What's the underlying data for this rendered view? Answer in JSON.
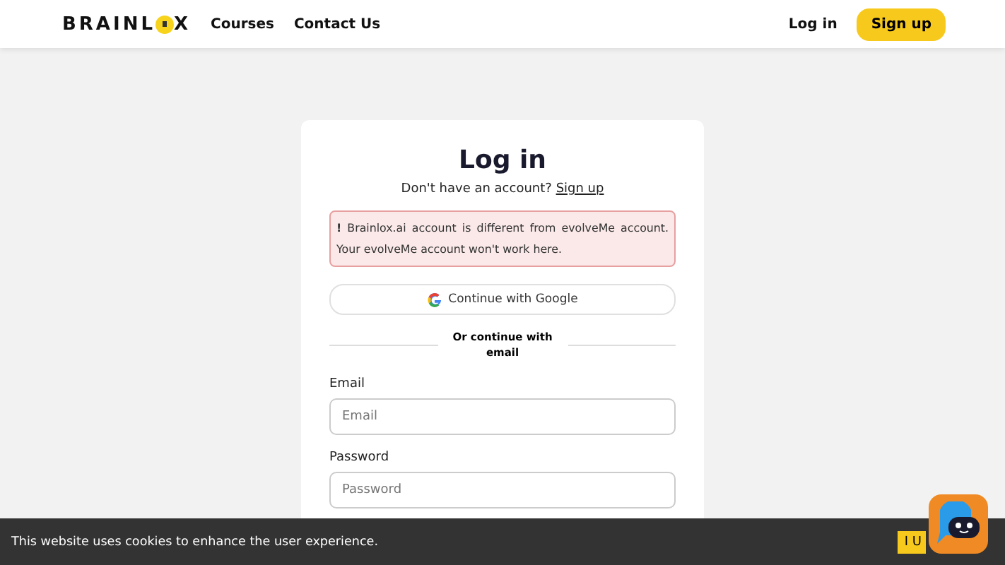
{
  "header": {
    "logo": "BRAINL",
    "logo_end": "X",
    "nav": [
      "Courses",
      "Contact Us"
    ],
    "login": "Log in",
    "signup": "Sign up"
  },
  "card": {
    "title": "Log in",
    "prompt": "Don't have an account?",
    "prompt_link": "Sign up",
    "alert": "**!** Brainlox.ai account is different from evolveMe account. Your evolveMe account won't work here.",
    "google": "Continue with Google",
    "divider": "Or continue with email",
    "fields": [
      {
        "label": "Email",
        "placeholder": "Email"
      },
      {
        "label": "Password",
        "placeholder": "Password"
      }
    ]
  },
  "cookie": {
    "text": "This website uses cookies to enhance the user experience.",
    "button": "I U"
  }
}
